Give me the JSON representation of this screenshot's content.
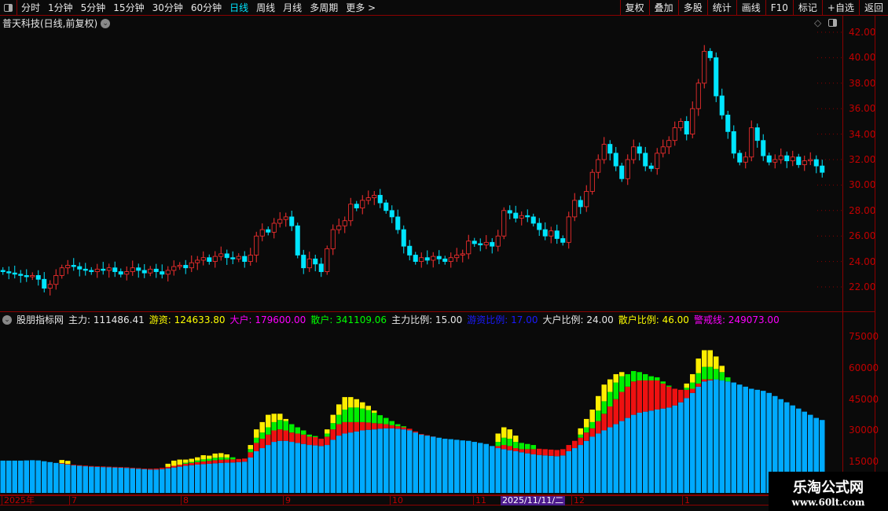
{
  "toolbar": {
    "periods": [
      "分时",
      "1分钟",
      "5分钟",
      "15分钟",
      "30分钟",
      "60分钟",
      "日线",
      "周线",
      "月线",
      "多周期",
      "更多 >"
    ],
    "active": "日线",
    "right": [
      "复权",
      "叠加",
      "多股",
      "统计",
      "画线",
      "F10",
      "标记",
      "+自选",
      "返回"
    ]
  },
  "title": "普天科技(日线,前复权)",
  "price_axis": [
    "42.00",
    "40.00",
    "38.00",
    "36.00",
    "34.00",
    "32.00",
    "30.00",
    "28.00",
    "26.00",
    "24.00",
    "22.00"
  ],
  "indicator": {
    "name": "股朋指标网",
    "items": [
      {
        "label": "主力: 111486.41",
        "color": "#e8e8e8"
      },
      {
        "label": "游资: 124633.80",
        "color": "#ffff00"
      },
      {
        "label": "大户: 179600.00",
        "color": "#ff00ff"
      },
      {
        "label": "散户: 341109.06",
        "color": "#00ff00"
      },
      {
        "label": "主力比例: 15.00",
        "color": "#e8e8e8"
      },
      {
        "label": "游资比例: 17.00",
        "color": "#1a1aff"
      },
      {
        "label": "大户比例: 24.00",
        "color": "#e8e8e8"
      },
      {
        "label": "散户比例: 46.00",
        "color": "#ffff00"
      },
      {
        "label": "警戒线: 249073.00",
        "color": "#ff00ff"
      }
    ],
    "axis": [
      "75000",
      "60000",
      "45000",
      "30000",
      "15000"
    ]
  },
  "date_axis": {
    "labels": [
      "2025年",
      "7",
      "8",
      "9",
      "10",
      "11",
      "12",
      "1"
    ],
    "cursor": "2025/11/11/二"
  },
  "watermark": {
    "name": "乐淘公式网",
    "url": "www.60lt.com"
  },
  "colors": {
    "up": "#ff3030",
    "down": "#00e5ff",
    "blue": "#00aaff",
    "red": "#ee1111",
    "green": "#00ee00",
    "yellow": "#ffee00"
  },
  "chart_data": {
    "type": "candlestick+stacked-bar",
    "close": [
      23.2,
      23.1,
      23.0,
      22.9,
      22.8,
      22.9,
      22.6,
      21.9,
      22.2,
      22.9,
      23.5,
      23.7,
      23.6,
      23.4,
      23.3,
      23.2,
      23.4,
      23.3,
      23.5,
      23.2,
      23.0,
      23.2,
      23.5,
      23.3,
      23.1,
      23.4,
      23.2,
      23.0,
      23.3,
      23.6,
      23.7,
      23.5,
      23.9,
      24.1,
      24.3,
      24.0,
      24.4,
      24.6,
      24.3,
      24.2,
      24.4,
      24.0,
      24.5,
      26.0,
      26.5,
      26.3,
      27.0,
      27.3,
      27.5,
      26.8,
      24.5,
      23.5,
      24.2,
      23.8,
      23.2,
      25.0,
      26.5,
      26.8,
      27.2,
      28.5,
      28.2,
      28.8,
      29.0,
      29.2,
      28.6,
      28.0,
      27.5,
      26.5,
      25.2,
      24.5,
      24.0,
      24.3,
      24.1,
      24.4,
      24.2,
      24.0,
      24.3,
      24.5,
      24.6,
      25.6,
      25.4,
      25.3,
      25.5,
      25.2,
      26.0,
      28.0,
      27.8,
      27.4,
      27.6,
      27.5,
      27.0,
      26.5,
      26.0,
      26.4,
      25.8,
      25.5,
      27.5,
      28.8,
      28.3,
      29.5,
      31.0,
      32.0,
      33.2,
      32.5,
      31.5,
      30.5,
      32.0,
      33.0,
      32.5,
      31.5,
      31.3,
      32.5,
      33.0,
      33.5,
      34.5,
      35.0,
      34.0,
      36.0,
      38.0,
      40.5,
      40.0,
      37.0,
      35.5,
      34.2,
      32.5,
      31.8,
      32.2,
      34.5,
      33.5,
      32.3,
      31.8,
      32.0,
      32.3,
      31.9,
      32.2,
      31.6,
      31.9,
      32.0,
      31.5,
      31.0
    ],
    "price_range": [
      21,
      43
    ],
    "indicator_range": [
      0,
      80000
    ],
    "blue": [
      15500,
      15500,
      15500,
      15500,
      15600,
      15700,
      15600,
      15200,
      14800,
      14400,
      14000,
      13600,
      13200,
      13000,
      12800,
      12600,
      12500,
      12400,
      12300,
      12200,
      12100,
      12000,
      11800,
      11600,
      11400,
      11200,
      11200,
      11400,
      11800,
      12200,
      12600,
      13000,
      13300,
      13600,
      13800,
      14000,
      14200,
      14400,
      14500,
      14600,
      14800,
      15000,
      17000,
      20000,
      21500,
      23000,
      24500,
      25000,
      25000,
      24500,
      24000,
      23500,
      23000,
      22800,
      22500,
      23000,
      25500,
      27500,
      28500,
      29000,
      29500,
      30000,
      30300,
      30500,
      30800,
      31000,
      31000,
      30800,
      30500,
      30000,
      29000,
      28000,
      27500,
      27000,
      26500,
      26000,
      25800,
      25500,
      25200,
      25000,
      24500,
      24000,
      23500,
      22500,
      21500,
      21000,
      20500,
      20000,
      19500,
      19000,
      18500,
      18200,
      18000,
      17800,
      17600,
      18000,
      20000,
      21500,
      23000,
      25000,
      27000,
      28500,
      30000,
      31500,
      33000,
      34500,
      36000,
      37500,
      38500,
      39000,
      39500,
      40000,
      40500,
      41000,
      42000,
      43500,
      45500,
      48000,
      51000,
      53500,
      54000,
      54500,
      54000,
      53500,
      53000,
      52000,
      51000,
      50000,
      49500,
      49000,
      48000,
      46500,
      45000,
      43500,
      42000,
      40500,
      39000,
      37500,
      36000,
      35000
    ],
    "red": [
      0,
      0,
      0,
      0,
      0,
      0,
      0,
      0,
      0,
      0,
      300,
      300,
      300,
      300,
      300,
      300,
      300,
      300,
      300,
      300,
      300,
      300,
      300,
      300,
      300,
      400,
      500,
      600,
      700,
      800,
      900,
      1000,
      1100,
      1200,
      1300,
      1400,
      1500,
      1500,
      1500,
      1500,
      1500,
      1500,
      2500,
      4000,
      4500,
      5000,
      5500,
      5500,
      5000,
      4500,
      4500,
      4500,
      4000,
      4000,
      3500,
      4000,
      5000,
      5500,
      5500,
      5000,
      4500,
      4000,
      3500,
      3000,
      2500,
      2000,
      1500,
      1200,
      1000,
      800,
      500,
      300,
      200,
      100,
      0,
      0,
      0,
      0,
      0,
      0,
      0,
      0,
      0,
      0,
      1000,
      2000,
      2000,
      1500,
      1500,
      2000,
      2500,
      3000,
      3000,
      3000,
      3000,
      3000,
      3000,
      3500,
      3500,
      4000,
      4000,
      6000,
      8000,
      10000,
      12000,
      14000,
      15000,
      16000,
      15500,
      15000,
      14500,
      14000,
      12000,
      10000,
      8000,
      6000,
      4000,
      2000,
      1500,
      1000,
      500,
      0,
      0,
      0,
      0,
      0,
      0,
      0,
      0,
      0,
      0,
      0,
      0,
      0,
      0,
      0,
      0,
      0,
      0,
      0
    ],
    "green": [
      0,
      0,
      0,
      0,
      0,
      0,
      0,
      0,
      0,
      0,
      0,
      0,
      0,
      0,
      0,
      0,
      0,
      0,
      0,
      0,
      0,
      0,
      0,
      0,
      0,
      0,
      0,
      0,
      0,
      0,
      0,
      500,
      500,
      800,
      1000,
      1000,
      1200,
      1200,
      1000,
      1000,
      0,
      0,
      1500,
      2500,
      3000,
      3500,
      4000,
      4500,
      4500,
      4000,
      3000,
      2000,
      1000,
      500,
      0,
      1500,
      3000,
      4500,
      6000,
      7000,
      7000,
      6500,
      6000,
      5000,
      4000,
      3000,
      2000,
      1000,
      500,
      0,
      0,
      0,
      0,
      0,
      0,
      0,
      0,
      0,
      0,
      0,
      0,
      0,
      0,
      0,
      2000,
      3500,
      3500,
      3000,
      3000,
      2500,
      2000,
      0,
      0,
      0,
      0,
      0,
      0,
      0,
      1500,
      2500,
      3000,
      5000,
      6000,
      7000,
      8000,
      7500,
      6000,
      5000,
      4000,
      3000,
      2000,
      1500,
      1000,
      500,
      0,
      0,
      1000,
      3000,
      5000,
      6000,
      6000,
      5000,
      4000,
      2000,
      0,
      0,
      0,
      0,
      0,
      0,
      0,
      0,
      0,
      0,
      0,
      0,
      0,
      0,
      0,
      0
    ],
    "yellow": [
      0,
      0,
      0,
      0,
      0,
      0,
      0,
      0,
      0,
      0,
      1500,
      1500,
      0,
      0,
      0,
      0,
      0,
      0,
      0,
      0,
      0,
      0,
      0,
      0,
      0,
      0,
      0,
      0,
      1500,
      2500,
      2500,
      1500,
      1500,
      1500,
      2000,
      1500,
      2000,
      2000,
      1500,
      0,
      0,
      0,
      2000,
      4000,
      5000,
      6000,
      4000,
      3000,
      1000,
      0,
      0,
      0,
      0,
      0,
      0,
      2000,
      4000,
      5000,
      6000,
      5000,
      4000,
      3000,
      2000,
      1000,
      0,
      0,
      0,
      0,
      0,
      0,
      0,
      0,
      0,
      0,
      0,
      0,
      0,
      0,
      0,
      0,
      0,
      0,
      0,
      0,
      4000,
      5000,
      4500,
      3000,
      0,
      0,
      0,
      0,
      0,
      0,
      0,
      0,
      0,
      0,
      3000,
      4000,
      6000,
      7000,
      8000,
      6000,
      4000,
      2000,
      0,
      0,
      0,
      0,
      0,
      0,
      0,
      0,
      0,
      0,
      2000,
      4000,
      7000,
      8000,
      8000,
      6000,
      3000,
      0,
      0,
      0,
      0,
      0,
      0,
      0,
      0,
      0,
      0,
      0,
      0,
      0,
      0,
      0,
      0,
      0
    ]
  }
}
